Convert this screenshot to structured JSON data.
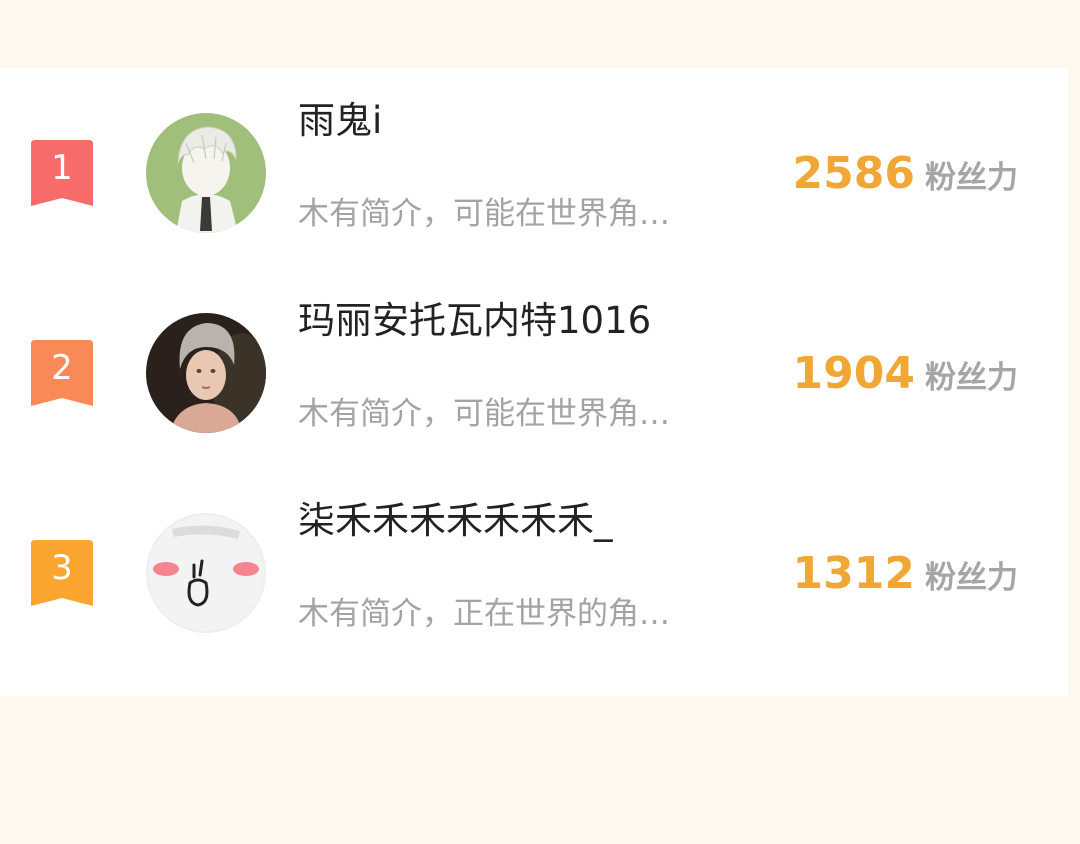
{
  "fans_label": "粉丝力",
  "colors": {
    "rank1": "#f76b6b",
    "rank2": "#f98a57",
    "rank3": "#f9a52f",
    "fans_count": "#f0a736",
    "bio": "#a3a3a3",
    "name": "#222222"
  },
  "ranking": [
    {
      "rank": "1",
      "name": "雨鬼i",
      "bio": "木有简介，可能在世界角…",
      "fans": "2586",
      "avatar": "anime-boy-sketch-avatar"
    },
    {
      "rank": "2",
      "name": "玛丽安托瓦内特1016",
      "bio": "木有简介，可能在世界角…",
      "fans": "1904",
      "avatar": "portrait-painting-avatar"
    },
    {
      "rank": "3",
      "name": "柒禾禾禾禾禾禾禾_",
      "bio": "木有简介，正在世界的角…",
      "fans": "1312",
      "avatar": "blushing-face-avatar"
    }
  ]
}
